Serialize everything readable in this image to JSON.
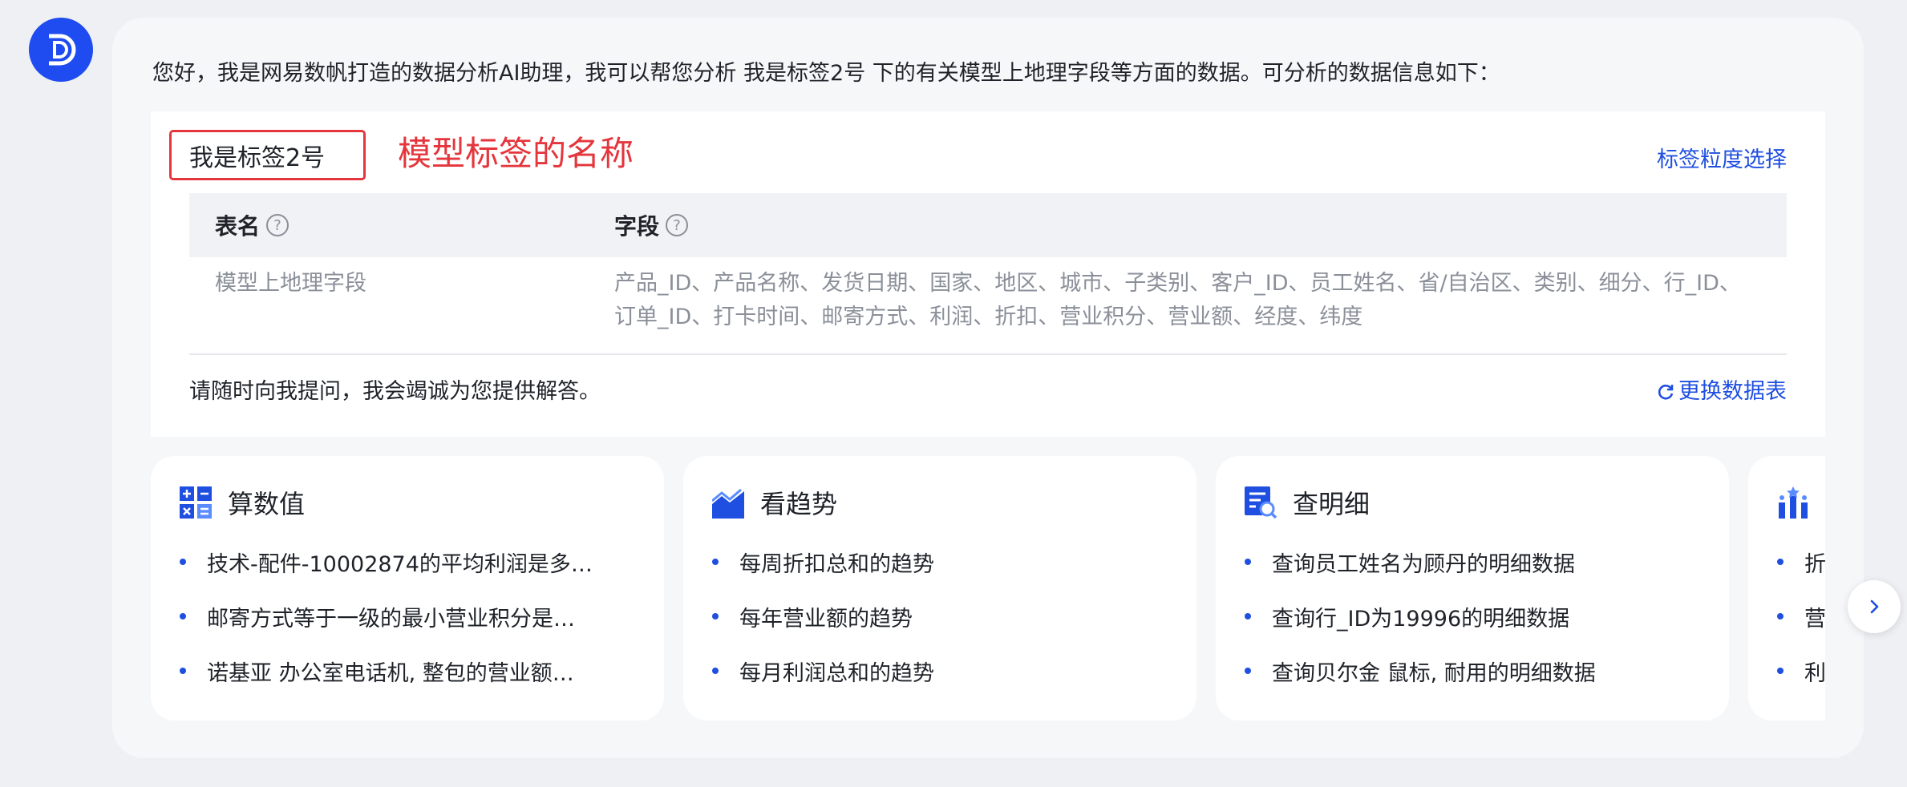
{
  "intro": "您好，我是网易数帆打造的数据分析AI助理，我可以帮您分析 我是标签2号 下的有关模型上地理字段等方面的数据。可分析的数据信息如下：",
  "model_tag": {
    "name": "我是标签2号",
    "annotation": "模型标签的名称",
    "granularity_link": "标签粒度选择"
  },
  "table": {
    "headers": [
      "表名",
      "字段"
    ],
    "rows": [
      {
        "name": "模型上地理字段",
        "fields": "产品_ID、产品名称、发货日期、国家、地区、城市、子类别、客户_ID、员工姓名、省/自治区、类别、细分、行_ID、订单_ID、打卡时间、邮寄方式、利润、折扣、营业积分、营业额、经度、纬度"
      }
    ]
  },
  "footer": {
    "text": "请随时向我提问，我会竭诚为您提供解答。",
    "change_table": "更换数据表"
  },
  "cards": [
    {
      "title": "算数值",
      "icon": "calculator-icon",
      "items": [
        "技术-配件-10002874的平均利润是多…",
        "邮寄方式等于一级的最小营业积分是…",
        "诺基亚 办公室电话机, 整包的营业额…"
      ]
    },
    {
      "title": "看趋势",
      "icon": "trend-icon",
      "items": [
        "每周折扣总和的趋势",
        "每年营业额的趋势",
        "每月利润总和的趋势"
      ]
    },
    {
      "title": "查明细",
      "icon": "detail-search-icon",
      "items": [
        "查询员工姓名为顾丹的明细数据",
        "查询行_ID为19996的明细数据",
        "查询贝尔金 鼠标, 耐用的明细数据"
      ]
    },
    {
      "title": "",
      "icon": "ranking-icon",
      "items": [
        "折",
        "营",
        "利"
      ]
    }
  ],
  "colors": {
    "accent": "#1f4fe0",
    "annotation_red": "#e4363c",
    "brand": "#1e4cf0"
  }
}
